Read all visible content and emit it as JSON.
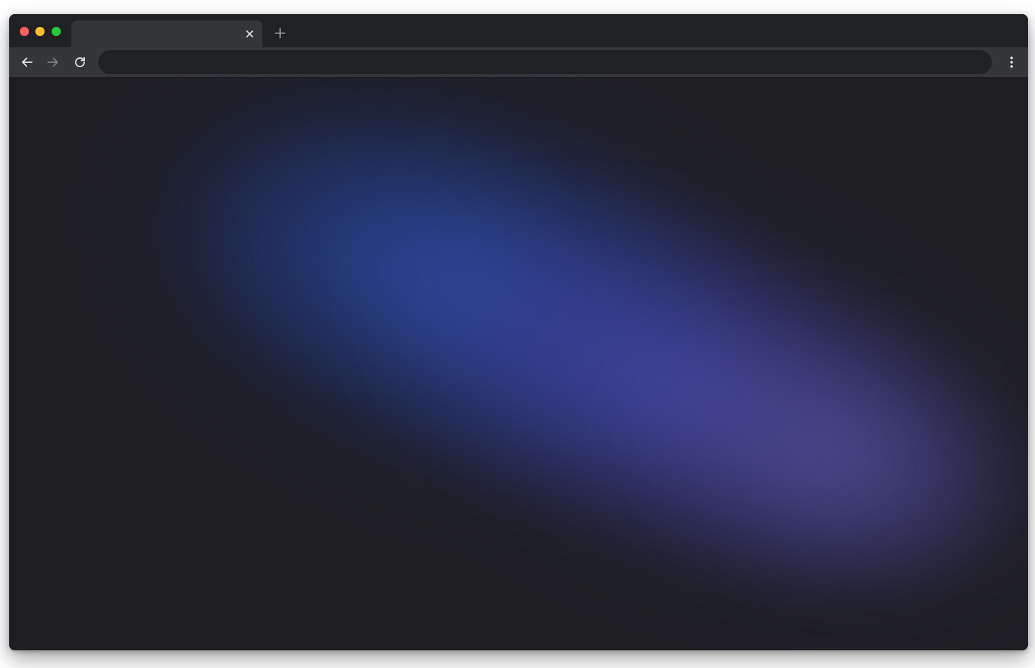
{
  "browser": {
    "tab": {
      "title": "",
      "close_icon": "close-icon"
    },
    "new_tab_icon": "plus-icon",
    "toolbar": {
      "back_icon": "arrow-left-icon",
      "forward_icon": "arrow-right-icon",
      "reload_icon": "reload-icon",
      "address_value": "",
      "address_placeholder": "",
      "menu_icon": "kebab-menu-icon"
    },
    "window_controls": {
      "close_color": "#ff5f57",
      "minimize_color": "#febc2e",
      "maximize_color": "#28c840"
    }
  },
  "theme": {
    "chrome_dark": "#202124",
    "toolbar": "#35363a",
    "page_background": "#1d1d22",
    "accent_blue": "#2d58be",
    "accent_violet": "#5a58b8"
  }
}
